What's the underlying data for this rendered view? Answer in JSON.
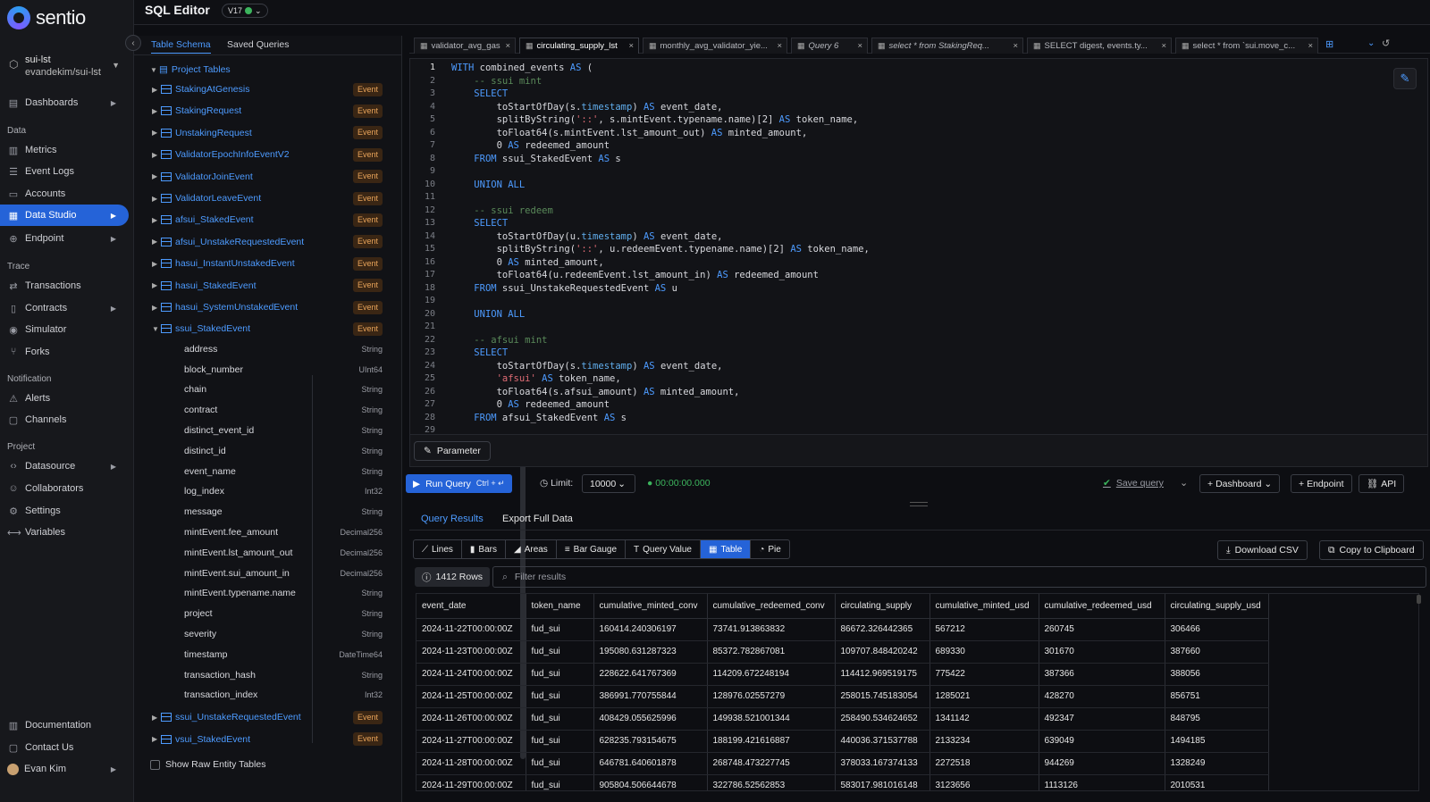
{
  "app": {
    "logo": "sentio",
    "page_title": "SQL Editor",
    "version": "V17"
  },
  "project": {
    "name": "sui-lst",
    "owner": "evandekim/sui-lst"
  },
  "nav": {
    "dashboards": "Dashboards",
    "data_section": "Data",
    "metrics": "Metrics",
    "event_logs": "Event Logs",
    "accounts": "Accounts",
    "data_studio": "Data Studio",
    "endpoint": "Endpoint",
    "trace_section": "Trace",
    "transactions": "Transactions",
    "contracts": "Contracts",
    "simulator": "Simulator",
    "forks": "Forks",
    "notification_section": "Notification",
    "alerts": "Alerts",
    "channels": "Channels",
    "project_section": "Project",
    "datasource": "Datasource",
    "collaborators": "Collaborators",
    "settings": "Settings",
    "variables": "Variables",
    "documentation": "Documentation",
    "contact_us": "Contact Us",
    "user": "Evan Kim"
  },
  "schema": {
    "tab_schema": "Table Schema",
    "tab_saved": "Saved Queries",
    "root": "Project Tables",
    "badge": "Event",
    "tables_before": [
      "StakingAtGenesis",
      "StakingRequest",
      "UnstakingRequest",
      "ValidatorEpochInfoEventV2",
      "ValidatorJoinEvent",
      "ValidatorLeaveEvent",
      "afsui_StakedEvent",
      "afsui_UnstakeRequestedEvent",
      "hasui_InstantUnstakedEvent",
      "hasui_StakedEvent",
      "hasui_SystemUnstakedEvent"
    ],
    "expanded_table": "ssui_StakedEvent",
    "fields": [
      {
        "name": "address",
        "type": "String"
      },
      {
        "name": "block_number",
        "type": "UInt64"
      },
      {
        "name": "chain",
        "type": "String"
      },
      {
        "name": "contract",
        "type": "String"
      },
      {
        "name": "distinct_event_id",
        "type": "String"
      },
      {
        "name": "distinct_id",
        "type": "String"
      },
      {
        "name": "event_name",
        "type": "String"
      },
      {
        "name": "log_index",
        "type": "Int32"
      },
      {
        "name": "message",
        "type": "String"
      },
      {
        "name": "mintEvent.fee_amount",
        "type": "Decimal256"
      },
      {
        "name": "mintEvent.lst_amount_out",
        "type": "Decimal256"
      },
      {
        "name": "mintEvent.sui_amount_in",
        "type": "Decimal256"
      },
      {
        "name": "mintEvent.typename.name",
        "type": "String"
      },
      {
        "name": "project",
        "type": "String"
      },
      {
        "name": "severity",
        "type": "String"
      },
      {
        "name": "timestamp",
        "type": "DateTime64"
      },
      {
        "name": "transaction_hash",
        "type": "String"
      },
      {
        "name": "transaction_index",
        "type": "Int32"
      }
    ],
    "tables_after": [
      "ssui_UnstakeRequestedEvent",
      "vsui_StakedEvent"
    ],
    "show_raw": "Show Raw Entity Tables"
  },
  "query_tabs": [
    {
      "label": "validator_avg_gas"
    },
    {
      "label": "circulating_supply_lst"
    },
    {
      "label": "monthly_avg_validator_yie..."
    },
    {
      "label": "Query 6"
    },
    {
      "label": "select * from StakingReq..."
    },
    {
      "label": "SELECT digest, events.ty..."
    },
    {
      "label": "select * from `sui.move_c..."
    }
  ],
  "editor": {
    "line_numbers": [
      "1",
      "2",
      "3",
      "4",
      "5",
      "6",
      "7",
      "8",
      "9",
      "10",
      "11",
      "12",
      "13",
      "14",
      "15",
      "16",
      "17",
      "18",
      "19",
      "20",
      "21",
      "22",
      "23",
      "24",
      "25",
      "26",
      "27",
      "28",
      "29"
    ],
    "parameter_button": "Parameter"
  },
  "runbar": {
    "run": "Run Query",
    "shortcut": "Ctrl + ↵",
    "limit_label": "Limit:",
    "limit_value": "10000",
    "elapsed": "00:00:00.000",
    "save": "Save query",
    "dashboard": "Dashboard",
    "endpoint": "Endpoint",
    "api": "API"
  },
  "results": {
    "tab_results": "Query Results",
    "tab_export": "Export Full Data",
    "viz": [
      "Lines",
      "Bars",
      "Areas",
      "Bar Gauge",
      "Query Value",
      "Table",
      "Pie"
    ],
    "download": "Download CSV",
    "copy": "Copy to Clipboard",
    "rows": "1412 Rows",
    "filter_placeholder": "Filter results",
    "columns": [
      "event_date",
      "token_name",
      "cumulative_minted_conv",
      "cumulative_redeemed_conv",
      "circulating_supply",
      "cumulative_minted_usd",
      "cumulative_redeemed_usd",
      "circulating_supply_usd"
    ],
    "rows_data": [
      [
        "2024-11-22T00:00:00Z",
        "fud_sui",
        "160414.240306197",
        "73741.913863832",
        "86672.326442365",
        "567212",
        "260745",
        "306466"
      ],
      [
        "2024-11-23T00:00:00Z",
        "fud_sui",
        "195080.631287323",
        "85372.782867081",
        "109707.848420242",
        "689330",
        "301670",
        "387660"
      ],
      [
        "2024-11-24T00:00:00Z",
        "fud_sui",
        "228622.641767369",
        "114209.672248194",
        "114412.969519175",
        "775422",
        "387366",
        "388056"
      ],
      [
        "2024-11-25T00:00:00Z",
        "fud_sui",
        "386991.770755844",
        "128976.02557279",
        "258015.745183054",
        "1285021",
        "428270",
        "856751"
      ],
      [
        "2024-11-26T00:00:00Z",
        "fud_sui",
        "408429.055625996",
        "149938.521001344",
        "258490.534624652",
        "1341142",
        "492347",
        "848795"
      ],
      [
        "2024-11-27T00:00:00Z",
        "fud_sui",
        "628235.793154675",
        "188199.421616887",
        "440036.371537788",
        "2133234",
        "639049",
        "1494185"
      ],
      [
        "2024-11-28T00:00:00Z",
        "fud_sui",
        "646781.640601878",
        "268748.473227745",
        "378033.167374133",
        "2272518",
        "944269",
        "1328249"
      ],
      [
        "2024-11-29T00:00:00Z",
        "fud_sui",
        "905804.506644678",
        "322786.52562853",
        "583017.981016148",
        "3123656",
        "1113126",
        "2010531"
      ]
    ]
  }
}
